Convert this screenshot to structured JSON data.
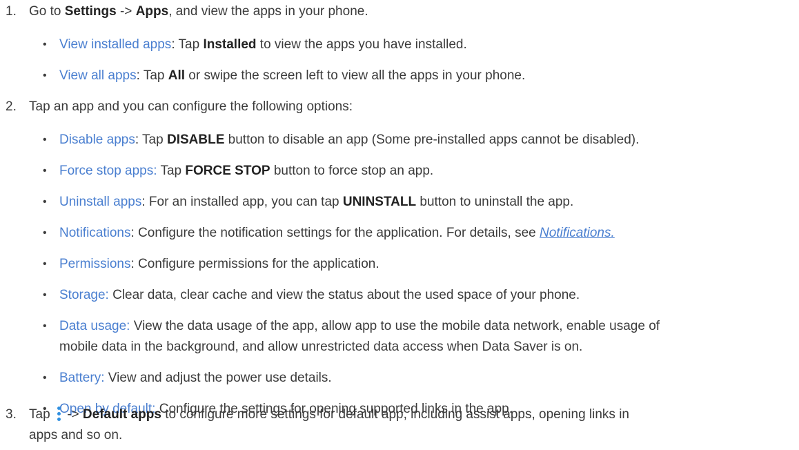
{
  "steps": [
    {
      "num": "1.",
      "parts": [
        "Go to ",
        "Settings",
        " -> ",
        "Apps",
        ", and view the apps in your phone."
      ]
    },
    {
      "num": "2.",
      "text": "Tap an app and you can configure the following options:"
    },
    {
      "num": "3.",
      "parts": [
        "Tap ",
        " -> ",
        "Default apps",
        " to configure more settings for default app, including assist apps, opening links in",
        "apps and so on."
      ],
      "icon": "more-vert-icon"
    }
  ],
  "step1_bullets": [
    {
      "lead": "View installed apps",
      "parts": [
        ": Tap ",
        "Installed",
        " to view the apps you have installed."
      ]
    },
    {
      "lead": "View all apps",
      "parts": [
        ": Tap ",
        "All",
        " or swipe the screen left to view all the apps in your phone."
      ]
    }
  ],
  "step2_bullets": [
    {
      "lead": "Disable apps",
      "parts": [
        ": Tap ",
        "DISABLE",
        " button to disable an app (Some pre-installed apps cannot be disabled)."
      ]
    },
    {
      "lead": "Force stop apps:",
      "parts": [
        " Tap ",
        "FORCE STOP",
        " button to force stop an app."
      ]
    },
    {
      "lead": "Uninstall apps",
      "parts": [
        ": For an installed app, you can tap ",
        "UNINSTALL",
        " button to uninstall the app."
      ]
    },
    {
      "lead": "Notifications",
      "parts": [
        ": Configure the notification settings for the application. For details, see "
      ],
      "link": "Notifications."
    },
    {
      "lead": "Permissions",
      "parts": [
        ": Configure permissions for the application."
      ]
    },
    {
      "lead": "Storage:",
      "parts": [
        " Clear data, clear cache and view the status about the used space of your phone."
      ]
    },
    {
      "lead": "Data usage:",
      "parts": [
        " View the data usage of the app, allow app to use the mobile data network, enable usage of",
        "mobile data in the background, and allow unrestricted data access when Data Saver is on."
      ]
    },
    {
      "lead": "Battery:",
      "parts": [
        " View and adjust the power use details."
      ]
    },
    {
      "lead": "Open by default:",
      "parts": [
        " Configure the settings for opening supported links in the app."
      ]
    }
  ],
  "bullet_glyph": "•",
  "accent_color": "#4a7fd0",
  "icon_color": "#2f8fe0"
}
